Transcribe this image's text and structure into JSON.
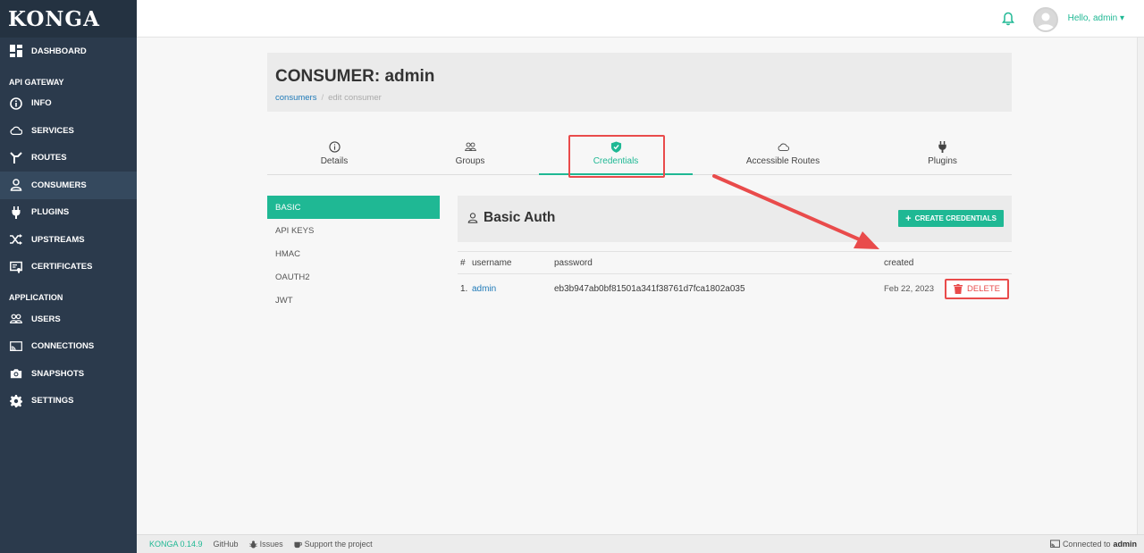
{
  "app": {
    "logo": "KONGA"
  },
  "sidebar": {
    "items": [
      {
        "label": "DASHBOARD",
        "icon": "dashboard-icon"
      },
      {
        "label": "INFO",
        "icon": "info-icon"
      },
      {
        "label": "SERVICES",
        "icon": "cloud-icon"
      },
      {
        "label": "ROUTES",
        "icon": "routes-icon"
      },
      {
        "label": "CONSUMERS",
        "icon": "user-icon",
        "active": true
      },
      {
        "label": "PLUGINS",
        "icon": "plug-icon"
      },
      {
        "label": "UPSTREAMS",
        "icon": "shuffle-icon"
      },
      {
        "label": "CERTIFICATES",
        "icon": "certificate-icon"
      },
      {
        "label": "USERS",
        "icon": "users-icon"
      },
      {
        "label": "CONNECTIONS",
        "icon": "cast-icon"
      },
      {
        "label": "SNAPSHOTS",
        "icon": "camera-icon"
      },
      {
        "label": "SETTINGS",
        "icon": "gear-icon"
      }
    ],
    "sections": {
      "api_gateway": "API GATEWAY",
      "application": "APPLICATION"
    }
  },
  "topbar": {
    "greeting": "Hello, admin ▾"
  },
  "page": {
    "title": "CONSUMER: admin",
    "breadcrumb": {
      "link": "consumers",
      "sep": "/",
      "current": "edit consumer"
    }
  },
  "tabs": [
    {
      "label": "Details",
      "icon": "info-icon"
    },
    {
      "label": "Groups",
      "icon": "users-icon"
    },
    {
      "label": "Credentials",
      "icon": "shield-icon",
      "active": true
    },
    {
      "label": "Accessible Routes",
      "icon": "cloud-icon"
    },
    {
      "label": "Plugins",
      "icon": "plug-icon"
    }
  ],
  "credential_types": [
    {
      "label": "BASIC",
      "active": true
    },
    {
      "label": "API KEYS"
    },
    {
      "label": "HMAC"
    },
    {
      "label": "OAUTH2"
    },
    {
      "label": "JWT"
    }
  ],
  "panel": {
    "title": "Basic Auth",
    "create_button": "CREATE CREDENTIALS",
    "create_plus": "+"
  },
  "table": {
    "headers": {
      "num": "#",
      "username": "username",
      "password": "password",
      "created": "created"
    },
    "rows": [
      {
        "num": "1.",
        "username": "admin",
        "password": "eb3b947ab0bf81501a341f38761d7fca1802a035",
        "created": "Feb 22, 2023",
        "action": "DELETE"
      }
    ]
  },
  "footer": {
    "version": "KONGA 0.14.9",
    "github": "GitHub",
    "issues": "Issues",
    "support": "Support the project",
    "connected_prefix": "Connected to",
    "connected_to": "admin"
  },
  "colors": {
    "accent": "#1fb894",
    "sidebar": "#2b3a4c",
    "annotation": "#e94b4b",
    "link": "#1f7ab8"
  }
}
